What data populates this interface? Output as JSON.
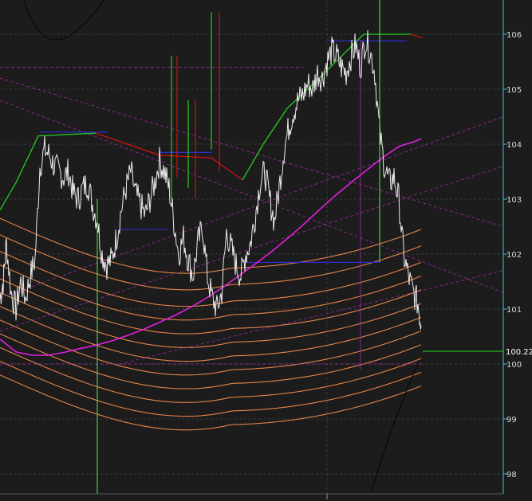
{
  "chart_data": {
    "type": "line",
    "title": "",
    "xlabel": "",
    "ylabel": "",
    "ylim": [
      97.8,
      106.6
    ],
    "y_ticks": [
      "98",
      "99",
      "100",
      "101",
      "102",
      "103",
      "104",
      "105",
      "106"
    ],
    "current_price_label": "100.22",
    "grid": true,
    "legend": "none",
    "colors": {
      "background": "#1c1c1c",
      "grid": "#3a3a3a",
      "axis": "#39c6d6",
      "price": "#ebebeb",
      "bands": "#f08a4b",
      "regression": "#e020e0",
      "trail_up": "#22cc22",
      "trail_down": "#cc1111",
      "level": "#2d2dcc",
      "projection": "#a02aa8",
      "marker": "#55ee55"
    },
    "series": [
      {
        "color": "#ebebeb",
        "x": [
          0,
          4,
          8,
          14,
          20,
          26,
          32,
          38,
          44,
          50,
          56,
          62,
          68,
          74,
          80,
          86,
          92,
          98,
          104,
          110,
          116,
          122,
          128,
          134,
          140,
          146,
          152,
          158,
          164,
          170,
          176,
          182,
          188,
          194,
          200,
          206,
          212,
          218,
          224,
          230,
          236,
          242,
          248,
          254,
          260,
          266,
          272,
          278,
          284,
          290,
          296,
          302,
          308,
          314,
          320,
          326,
          332,
          338,
          344,
          350,
          356,
          362,
          368,
          374,
          380,
          386,
          392,
          398,
          404,
          410,
          416,
          422,
          428,
          434,
          440,
          446,
          452,
          458,
          464,
          470,
          476,
          482,
          488,
          494,
          500,
          506,
          512,
          518,
          524,
          528
        ],
        "values": [
          101.2,
          101.5,
          102.2,
          101.3,
          101.0,
          101.5,
          101.2,
          101.6,
          101.9,
          103.6,
          103.9,
          103.8,
          103.6,
          103.5,
          103.4,
          103.5,
          103.1,
          103.0,
          103.2,
          103.3,
          102.9,
          102.6,
          102.0,
          101.8,
          101.9,
          102.3,
          102.8,
          103.2,
          103.5,
          103.1,
          102.9,
          102.7,
          103.0,
          103.3,
          103.7,
          103.5,
          103.2,
          102.6,
          102.0,
          102.3,
          101.9,
          101.6,
          102.2,
          102.5,
          101.6,
          101.2,
          101.0,
          101.3,
          102.4,
          102.1,
          101.8,
          101.6,
          102.0,
          102.2,
          102.7,
          103.3,
          103.5,
          103.0,
          102.6,
          103.2,
          103.9,
          104.3,
          104.6,
          104.8,
          104.9,
          105.1,
          105.0,
          105.3,
          105.2,
          105.5,
          105.7,
          105.6,
          105.4,
          105.3,
          105.6,
          105.8,
          105.4,
          105.9,
          105.7,
          105.3,
          104.2,
          103.6,
          103.3,
          103.4,
          103.0,
          102.0,
          101.6,
          101.3,
          101.1,
          100.7
        ]
      },
      {
        "color": "#e020e0",
        "x": [
          0,
          20,
          40,
          60,
          80,
          100,
          120,
          140,
          160,
          180,
          200,
          220,
          240,
          260,
          280,
          300,
          320,
          340,
          360,
          380,
          400,
          420,
          440,
          460,
          480,
          500,
          520,
          528
        ],
        "values": [
          100.45,
          100.22,
          100.16,
          100.16,
          100.21,
          100.28,
          100.34,
          100.42,
          100.52,
          100.63,
          100.76,
          100.89,
          101.04,
          101.21,
          101.4,
          101.61,
          101.82,
          102.04,
          102.28,
          102.53,
          102.8,
          103.06,
          103.3,
          103.53,
          103.76,
          103.96,
          104.05,
          104.1
        ]
      }
    ]
  }
}
